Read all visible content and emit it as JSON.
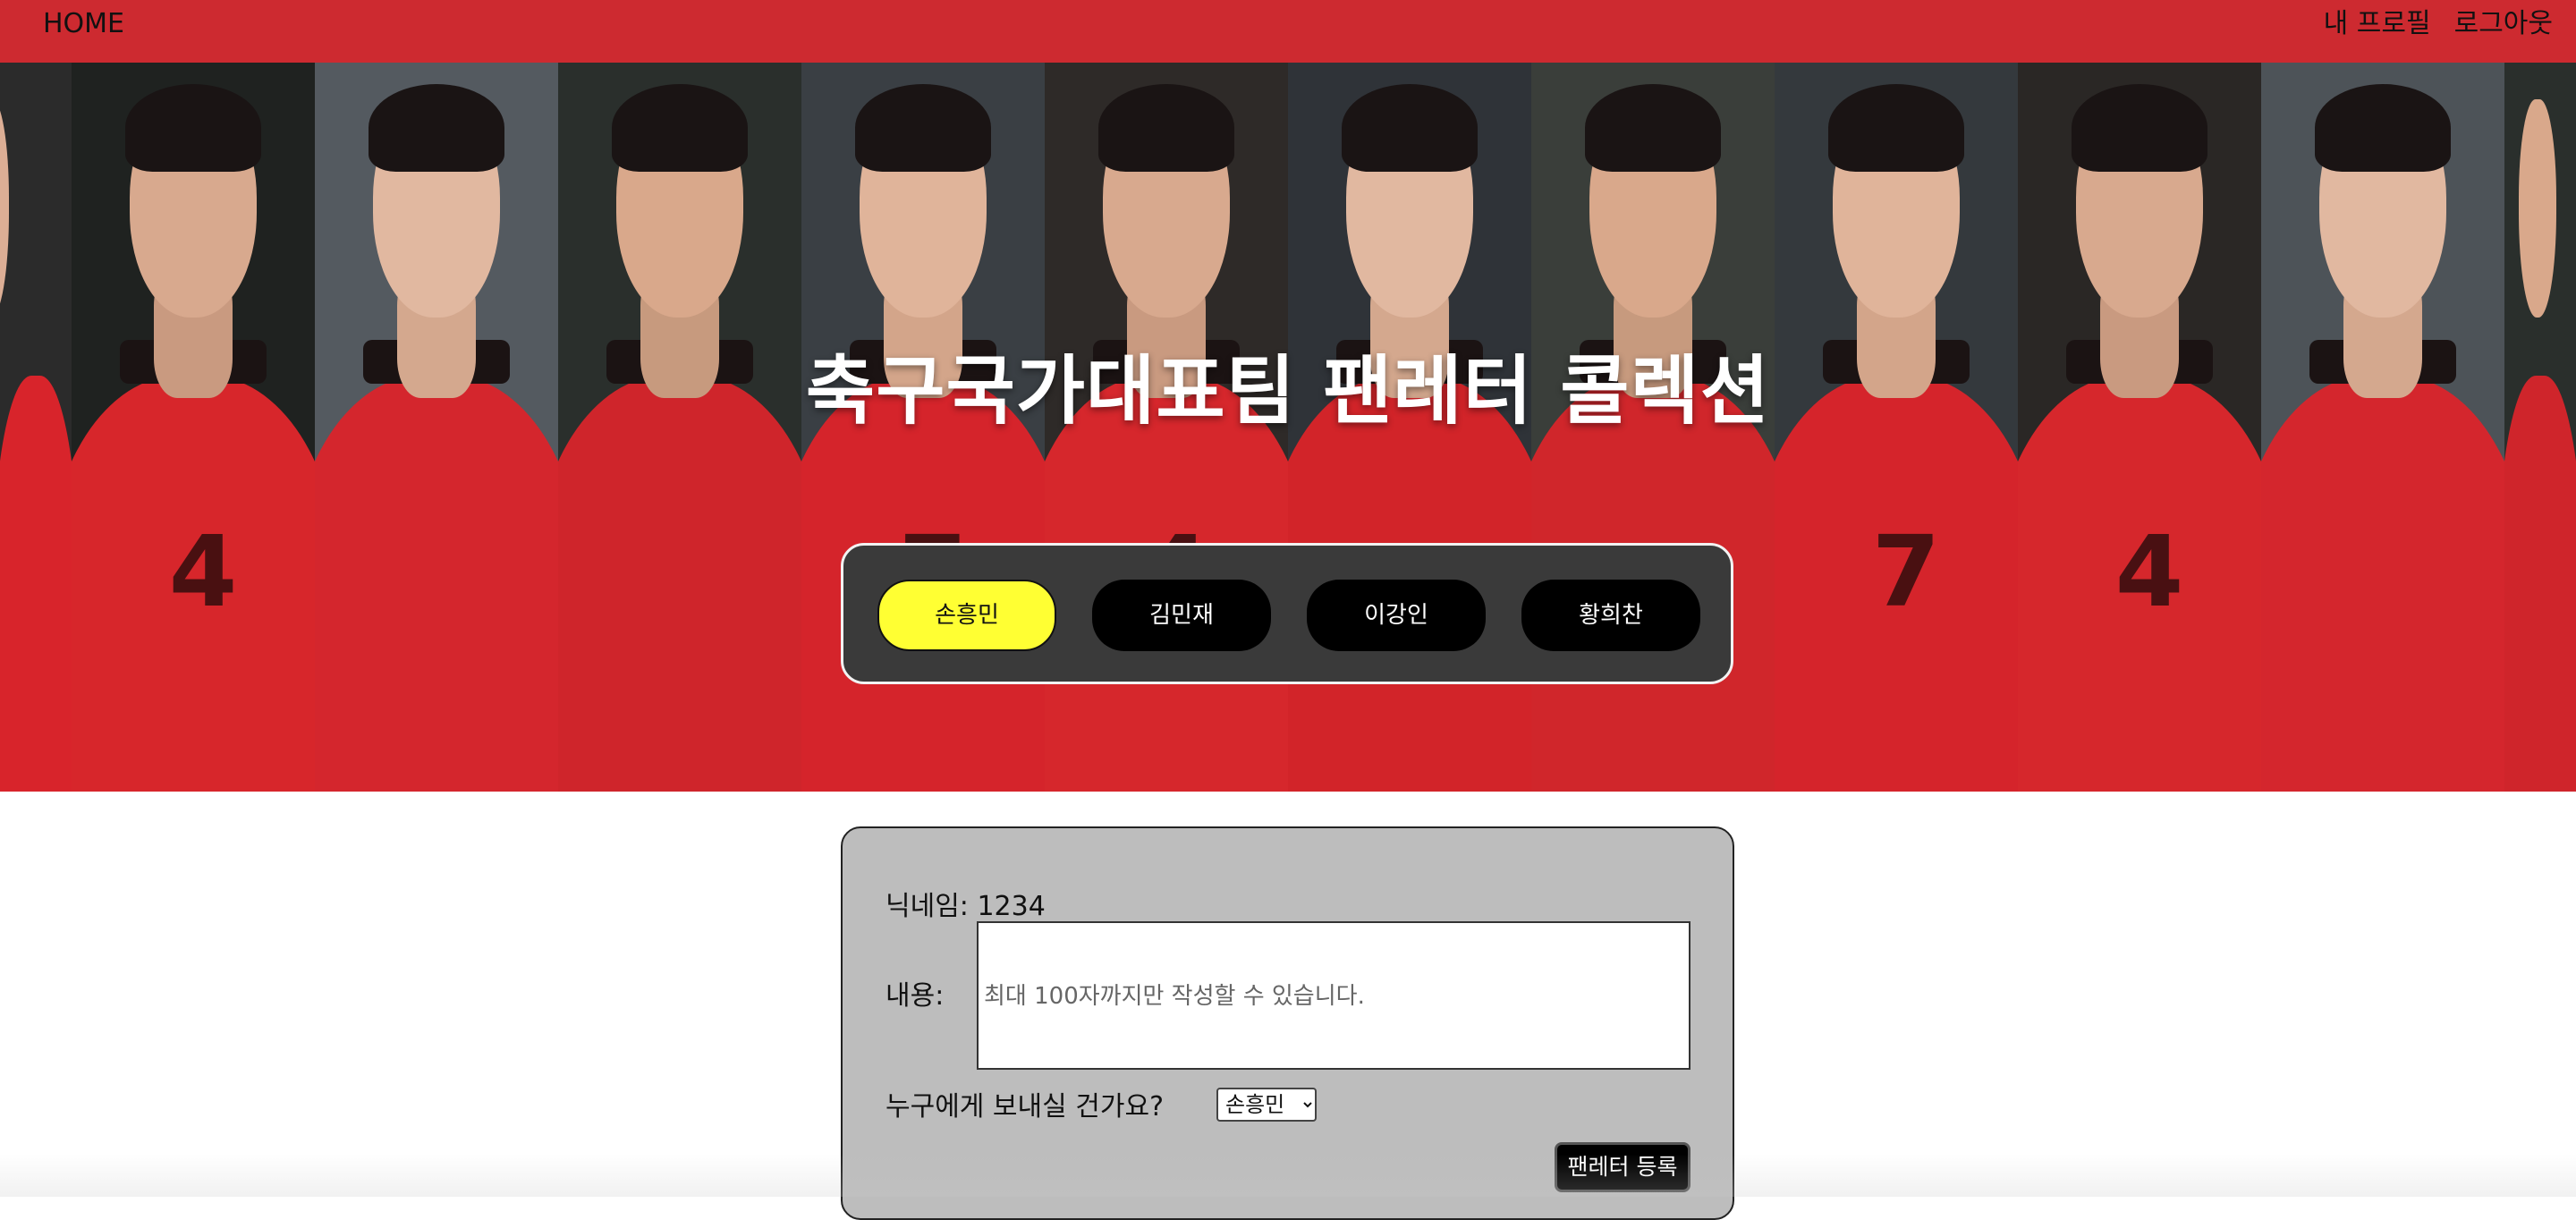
{
  "nav": {
    "home": "HOME",
    "profile": "내 프로필",
    "logout": "로그아웃"
  },
  "hero": {
    "title": "축구국가대표팀 팬레터 콜렉션"
  },
  "players": [
    {
      "label": "손흥민",
      "active": true
    },
    {
      "label": "김민재",
      "active": false
    },
    {
      "label": "이강인",
      "active": false
    },
    {
      "label": "황희찬",
      "active": false
    }
  ],
  "form": {
    "nickname": "닉네임: 1234",
    "content_label": "내용:",
    "content_placeholder": "최대 100자까지만 작성할 수 있습니다.",
    "content_value": "",
    "recipient_label": "누구에게 보내실 건가요?",
    "recipient_selected": "손흥민",
    "submit_label": "팬레터 등록"
  },
  "colors": {
    "nav_bg": "#cd2a30",
    "active_player": "#ffff33",
    "player_bar_bg": "#3a3a3a",
    "card_bg": "#bdbdbd"
  }
}
